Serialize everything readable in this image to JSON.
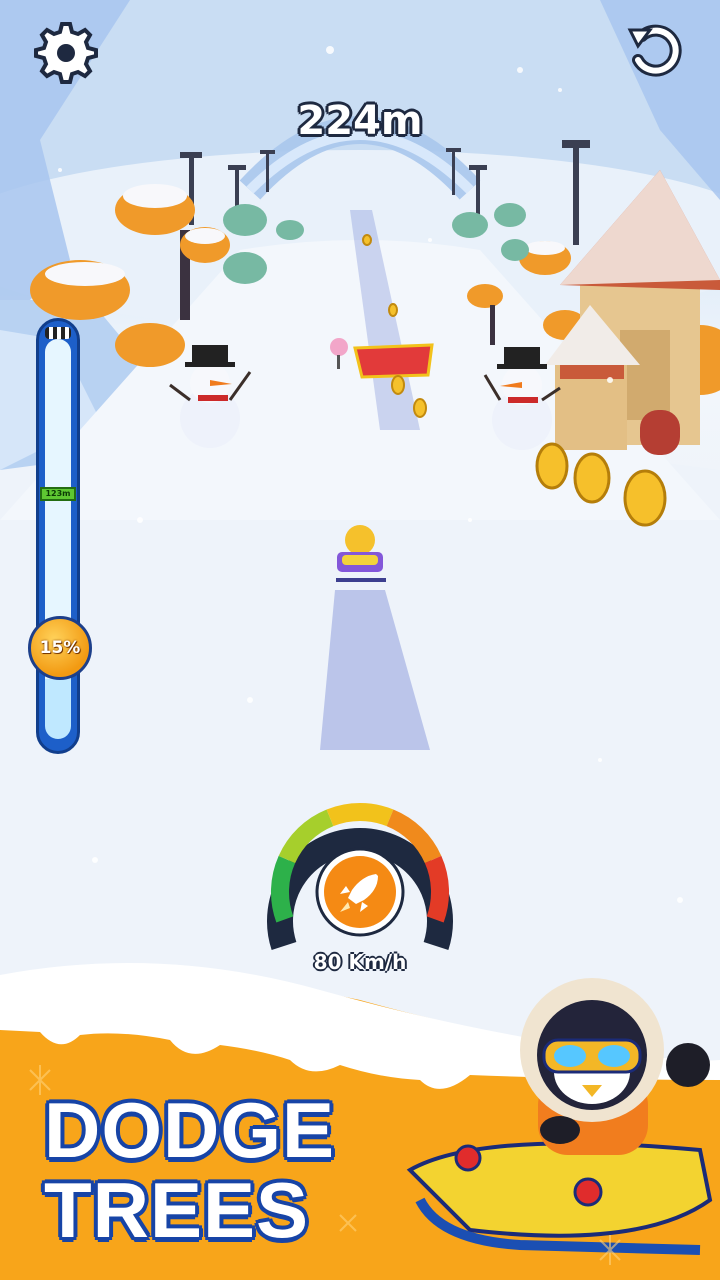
{
  "hud": {
    "distance": "224m",
    "settings_icon": "gear-icon",
    "restart_icon": "restart-icon"
  },
  "progress": {
    "marker_label": "123m",
    "percent_label": "15%",
    "percent_value": 0.15
  },
  "speedometer": {
    "speed_label": "80 Km/h",
    "boost_icon": "rocket-icon",
    "colors": [
      "#2db14a",
      "#a6cf2c",
      "#f2c21b",
      "#f08a1c",
      "#e33b26"
    ]
  },
  "banner": {
    "line1": "DODGE",
    "line2": "TREES",
    "accent": "#f4a417"
  },
  "scene": {
    "coins_icon": "coin-icon",
    "snowmen_icon": "snowman-icon",
    "character_icon": "penguin-sled-icon"
  }
}
